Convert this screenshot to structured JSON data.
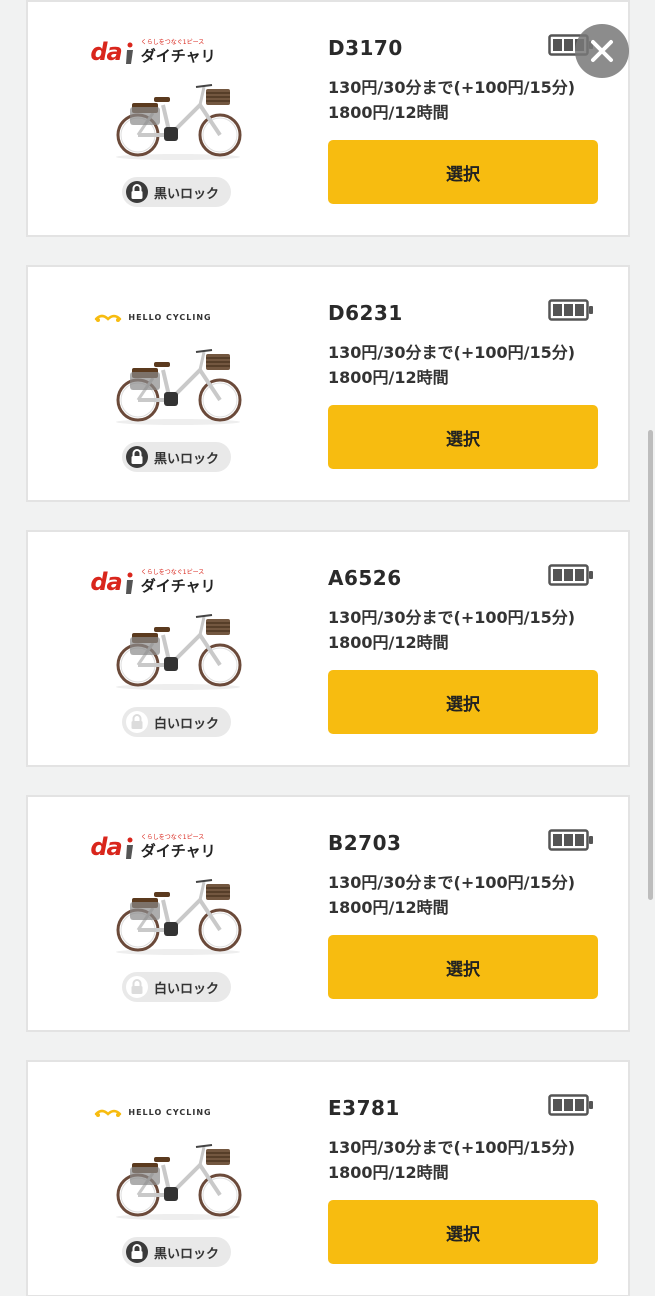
{
  "close_icon": "close-icon",
  "colors": {
    "accent_button": "#f7bc10",
    "card_bg": "#ffffff",
    "page_bg": "#f1f2f2",
    "dai_red": "#d9261c",
    "hello_yellow": "#f7bc10"
  },
  "bikes": [
    {
      "brand": "daichari",
      "brand_logo": {
        "tagline": "くらしをつなぐ1ピース",
        "name": "ダイチャリ"
      },
      "id": "D3170",
      "price_line1": "130円/30分まで(+100円/15分)",
      "price_line2": "1800円/12時間",
      "select_label": "選択",
      "lock_type": "black",
      "lock_label": "黒いロック",
      "battery_level": 0.75
    },
    {
      "brand": "hello-cycling",
      "brand_logo": {
        "name": "HELLO CYCLING"
      },
      "id": "D6231",
      "price_line1": "130円/30分まで(+100円/15分)",
      "price_line2": "1800円/12時間",
      "select_label": "選択",
      "lock_type": "black",
      "lock_label": "黒いロック",
      "battery_level": 0.75
    },
    {
      "brand": "daichari",
      "brand_logo": {
        "tagline": "くらしをつなぐ1ピース",
        "name": "ダイチャリ"
      },
      "id": "A6526",
      "price_line1": "130円/30分まで(+100円/15分)",
      "price_line2": "1800円/12時間",
      "select_label": "選択",
      "lock_type": "white",
      "lock_label": "白いロック",
      "battery_level": 0.75
    },
    {
      "brand": "daichari",
      "brand_logo": {
        "tagline": "くらしをつなぐ1ピース",
        "name": "ダイチャリ"
      },
      "id": "B2703",
      "price_line1": "130円/30分まで(+100円/15分)",
      "price_line2": "1800円/12時間",
      "select_label": "選択",
      "lock_type": "white",
      "lock_label": "白いロック",
      "battery_level": 0.75
    },
    {
      "brand": "hello-cycling",
      "brand_logo": {
        "name": "HELLO CYCLING"
      },
      "id": "E3781",
      "price_line1": "130円/30分まで(+100円/15分)",
      "price_line2": "1800円/12時間",
      "select_label": "選択",
      "lock_type": "black",
      "lock_label": "黒いロック",
      "battery_level": 0.75
    }
  ]
}
